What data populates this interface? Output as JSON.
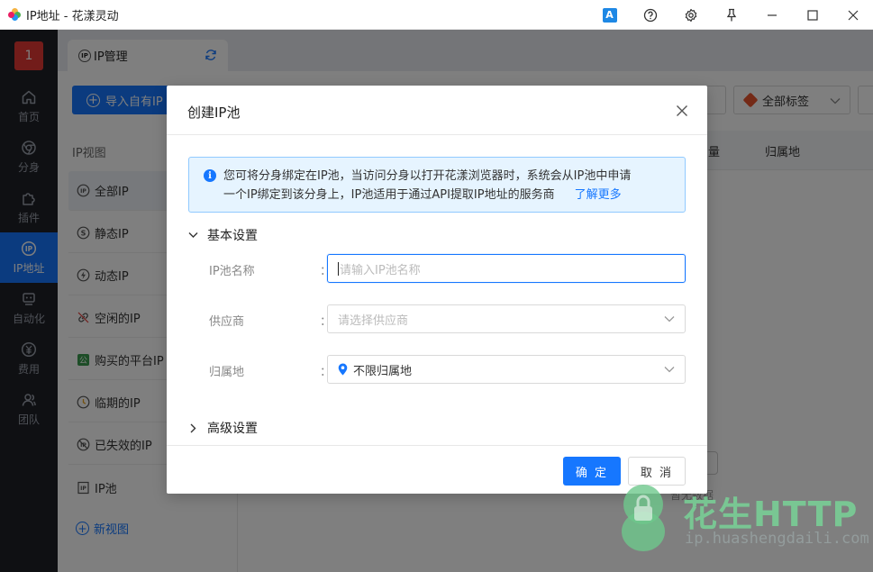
{
  "window": {
    "title": "IP地址 - 花漾灵动",
    "translate_label": "A"
  },
  "sidebar": {
    "user_badge": "1",
    "items": [
      {
        "label": "首页",
        "icon": "home-icon"
      },
      {
        "label": "分身",
        "icon": "browser-icon"
      },
      {
        "label": "插件",
        "icon": "puzzle-icon"
      },
      {
        "label": "IP地址",
        "icon": "ip-icon",
        "active": true
      },
      {
        "label": "自动化",
        "icon": "robot-icon"
      },
      {
        "label": "费用",
        "icon": "yen-icon"
      },
      {
        "label": "团队",
        "icon": "team-icon"
      }
    ],
    "accent": "#1677ff"
  },
  "tabs": {
    "active_tab": "IP管理",
    "ip_badge": "IP"
  },
  "toolbar": {
    "import_label": "导入自有IP",
    "tags_select": "全部标签"
  },
  "ip_view": {
    "title": "IP视图",
    "items": [
      {
        "label": "全部IP",
        "icon": "ip-circle-icon",
        "active": true
      },
      {
        "label": "静态IP",
        "icon": "static-icon"
      },
      {
        "label": "动态IP",
        "icon": "lightning-icon"
      },
      {
        "label": "空闲的IP",
        "icon": "link-icon"
      },
      {
        "label": "购买的平台IP",
        "icon": "platform-icon"
      },
      {
        "label": "临期的IP",
        "icon": "clock-icon"
      },
      {
        "label": "已失效的IP",
        "icon": "invalid-icon"
      },
      {
        "label": "IP池",
        "icon": "pool-icon"
      }
    ],
    "new_view": "新视图"
  },
  "table": {
    "headers": [
      "量",
      "归属地"
    ],
    "empty_text": "暂无数据"
  },
  "dialog": {
    "title": "创建IP池",
    "notice_line1": "您可将分身绑定在IP池，当访问分身以打开花漾浏览器时，系统会从IP池中申请",
    "notice_line2": "一个IP绑定到该分身上，IP池适用于通过API提取IP地址的服务商",
    "learn_more": "了解更多",
    "basic_section": "基本设置",
    "advanced_section": "高级设置",
    "fields": {
      "name_label": "IP池名称",
      "name_placeholder": "请输入IP池名称",
      "provider_label": "供应商",
      "provider_placeholder": "请选择供应商",
      "location_label": "归属地",
      "location_value": "不限归属地"
    },
    "colon": "：",
    "ok_label": "确 定",
    "cancel_label": "取 消"
  },
  "watermark": {
    "brand": "花生HTTP",
    "domain": "ip.huashengdaili.com"
  }
}
